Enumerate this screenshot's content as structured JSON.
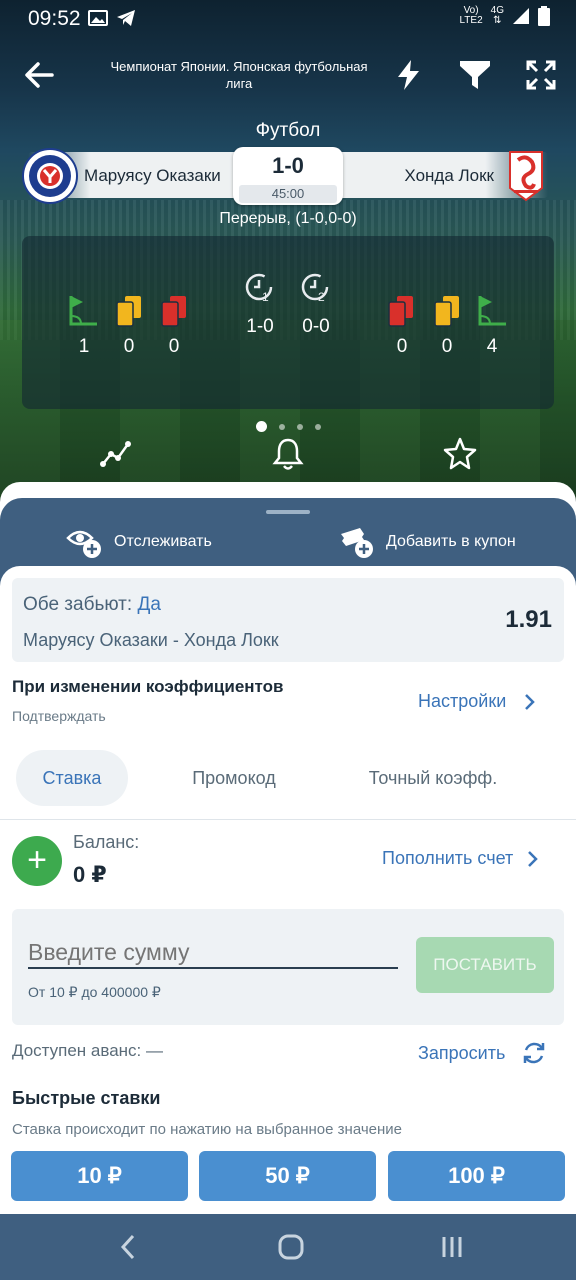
{
  "status_bar": {
    "time": "09:52",
    "network_top": "Vo)",
    "network_bottom": "LTE2",
    "signal_label": "4G"
  },
  "header": {
    "league": "Чемпионат Японии. Японская футбольная лига",
    "sport": "Футбол",
    "home_team": "Маруясу Оказаки",
    "away_team": "Хонда Локк",
    "score": "1-0",
    "clock": "45:00",
    "period": "Перерыв, (1-0,0-0)"
  },
  "stats": {
    "home": {
      "corners": "1",
      "yellow": "0",
      "red": "0"
    },
    "away": {
      "red": "0",
      "yellow": "0",
      "corners": "4"
    },
    "first_half": "1-0",
    "second_half": "0-0",
    "half1_label": "1",
    "half2_label": "2"
  },
  "sheet": {
    "track_label": "Отслеживать",
    "add_coupon_label": "Добавить в купон",
    "bet": {
      "market": "Обе забьют: ",
      "outcome": "Да",
      "match": "Маруясу Оказаки - Хонда Локк",
      "odds": "1.91"
    },
    "odds_change": {
      "title": "При изменении коэффициентов",
      "mode": "Подтверждать",
      "settings_label": "Настройки"
    },
    "tabs": [
      "Ставка",
      "Промокод",
      "Точный коэфф."
    ],
    "balance": {
      "label": "Баланс:",
      "value": "0 ₽",
      "topup_label": "Пополнить счет"
    },
    "stake": {
      "placeholder": "Введите сумму",
      "hint": "От 10 ₽ до 400000 ₽",
      "place_label": "ПОСТАВИТЬ"
    },
    "advance": {
      "label": "Доступен аванс: —",
      "request_label": "Запросить"
    },
    "quick": {
      "title": "Быстрые ставки",
      "subtitle": "Ставка происходит по нажатию на выбранное значение",
      "amounts": [
        "10 ₽",
        "50 ₽",
        "100 ₽"
      ]
    }
  },
  "colors": {
    "accent": "#3a74b8",
    "header_blue": "#3f5f80",
    "quick_bet_blue": "#4a8fd0",
    "place_disabled": "#a7d9b2",
    "balance_green": "#3daa4e",
    "yellow_card": "#f2b61e",
    "red_card": "#d9302b",
    "corner_green": "#3fae4a"
  }
}
